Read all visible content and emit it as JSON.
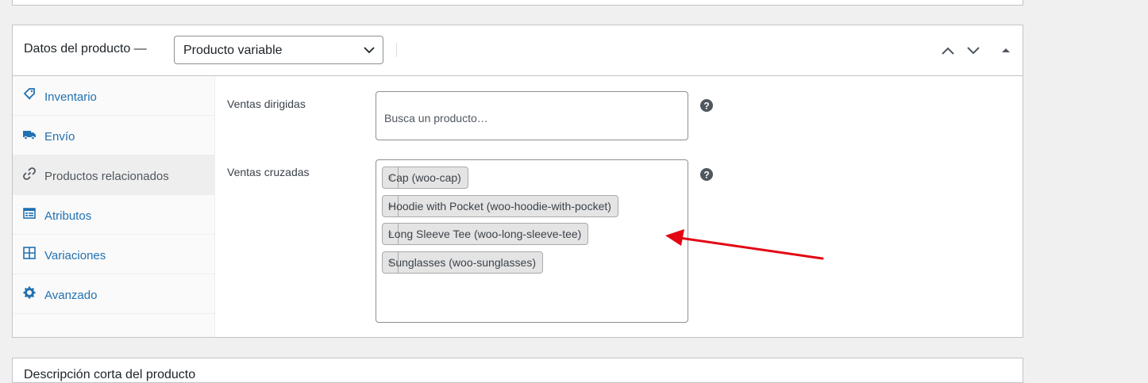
{
  "product_data": {
    "title": "Datos del producto —",
    "type_select": {
      "selected": "Producto variable"
    },
    "tabs": [
      {
        "label": "Inventario",
        "icon": "tag-icon"
      },
      {
        "label": "Envío",
        "icon": "truck-icon"
      },
      {
        "label": "Productos relacionados",
        "icon": "link-icon",
        "active": true
      },
      {
        "label": "Atributos",
        "icon": "list-icon"
      },
      {
        "label": "Variaciones",
        "icon": "grid-icon"
      },
      {
        "label": "Avanzado",
        "icon": "gear-icon"
      }
    ],
    "upsells": {
      "label": "Ventas dirigidas",
      "placeholder": "Busca un producto…"
    },
    "cross_sells": {
      "label": "Ventas cruzadas",
      "remove_symbol": "×",
      "items": [
        "Cap (woo-cap)",
        "Hoodie with Pocket (woo-hoodie-with-pocket)",
        "Long Sleeve Tee (woo-long-sleeve-tee)",
        "Sunglasses (woo-sunglasses)"
      ]
    }
  },
  "next_box": {
    "title": "Descripción corta del producto"
  },
  "colors": {
    "link": "#2271b1",
    "arrow": "#e30613",
    "border": "#c3c4c7"
  }
}
